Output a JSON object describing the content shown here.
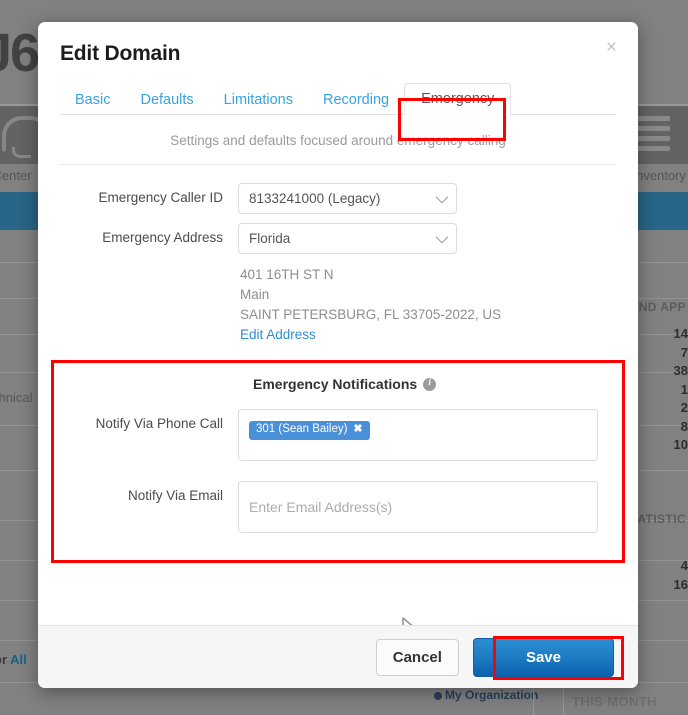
{
  "background": {
    "logo_text": "J6",
    "nav_left_label": "l Center",
    "nav_right_label": "nventory",
    "side_text_left": "chnical",
    "panel_heading_right": "AND APP",
    "panel_heading_stats": "STATISTIC",
    "stat_numbers": [
      "14",
      "7",
      "38",
      "1",
      "2",
      "8",
      "10"
    ],
    "stat_numbers_2": [
      "4",
      "16"
    ],
    "footer_link_muted": "or",
    "footer_link_text": "All",
    "org_label": "My Organization",
    "month_label": "THIS MONTH"
  },
  "modal": {
    "title": "Edit Domain",
    "close_label": "×",
    "subtitle": "Settings and defaults focused around emergency calling",
    "tabs": [
      {
        "label": "Basic",
        "active": false
      },
      {
        "label": "Defaults",
        "active": false
      },
      {
        "label": "Limitations",
        "active": false
      },
      {
        "label": "Recording",
        "active": false
      },
      {
        "label": "Emergency",
        "active": true
      }
    ],
    "fields": {
      "caller_id_label": "Emergency Caller ID",
      "caller_id_value": "8133241000 (Legacy)",
      "address_label": "Emergency Address",
      "address_value": "Florida",
      "address_lines": [
        "401 16TH ST N",
        "Main",
        "SAINT PETERSBURG, FL 33705-2022, US"
      ],
      "edit_address_link": "Edit Address"
    },
    "notifications": {
      "heading": "Emergency Notifications",
      "info_icon_glyph": "i",
      "phone_label": "Notify Via Phone Call",
      "phone_tags": [
        {
          "text": "301 (Sean Bailey)",
          "remove_glyph": "✖"
        }
      ],
      "email_label": "Notify Via Email",
      "email_value": "",
      "email_placeholder": "Enter Email Address(s)"
    },
    "footer": {
      "cancel_label": "Cancel",
      "save_label": "Save"
    }
  },
  "colors": {
    "tab_link": "#36a3e0",
    "link": "#2d8fd5",
    "tag_bg": "#4a90d9",
    "save_blue": "#1f7ec4",
    "highlight_red": "#fe0000",
    "band_blue": "#1b6186"
  }
}
